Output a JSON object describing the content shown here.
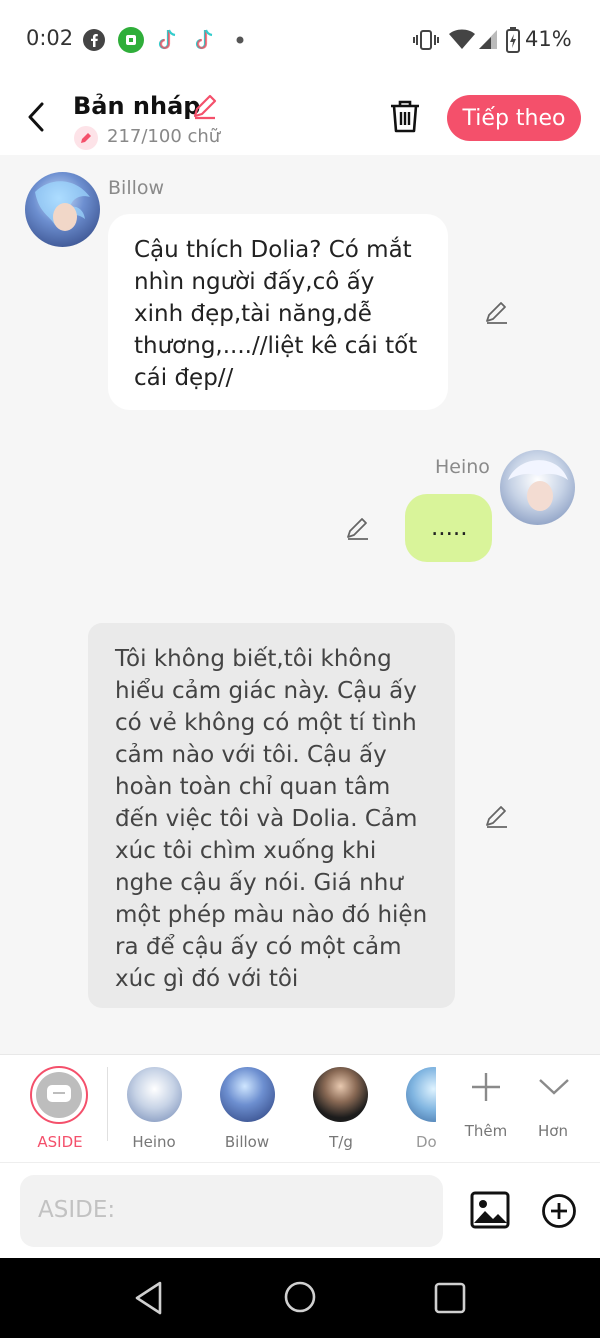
{
  "status_bar": {
    "time": "0:02",
    "battery": "41%",
    "icons": [
      "facebook-icon",
      "app-icon",
      "tiktok-icon",
      "tiktok-icon",
      "dot-icon",
      "vibrate-icon",
      "wifi-icon",
      "signal-icon",
      "battery-icon"
    ]
  },
  "header": {
    "title": "Bản nháp",
    "word_count": "217/100 chữ",
    "next_label": "Tiếp theo",
    "accent": "#f4506b"
  },
  "messages": [
    {
      "speaker": "Billow",
      "side": "left",
      "text": "Cậu thích Dolia? Có mắt nhìn người đấy,cô ấy xinh đẹp,tài năng,dễ thương,....//liệt kê cái tốt cái đẹp//",
      "bubble_color": "#ffffff"
    },
    {
      "speaker": "Heino",
      "side": "right",
      "text": ".....",
      "bubble_color": "#d9f49a"
    },
    {
      "speaker": "",
      "side": "aside",
      "text": "Tôi không biết,tôi không hiểu cảm giác này. Cậu ấy có vẻ không có một tí tình cảm nào với tôi. Cậu ấy hoàn toàn chỉ quan tâm đến việc tôi và Dolia. Cảm xúc tôi chìm xuống khi nghe cậu ấy nói. Giá như một phép màu nào đó hiện ra để cậu ấy có một cảm xúc gì đó với tôi",
      "bubble_color": "#eaeaea"
    }
  ],
  "cast": {
    "aside_label": "ASIDE",
    "members": [
      "Heino",
      "Billow",
      "T/g",
      "Do"
    ],
    "add_label": "Thêm",
    "more_label": "Hơn"
  },
  "composer": {
    "placeholder": "ASIDE:"
  }
}
